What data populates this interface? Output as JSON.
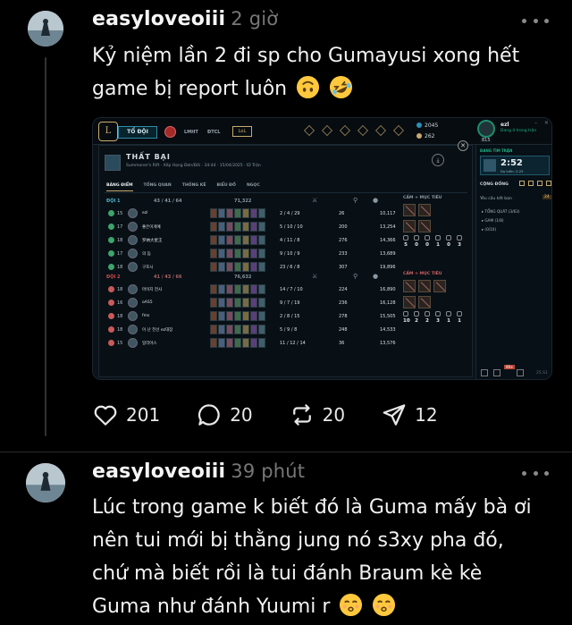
{
  "post1": {
    "username": "easyloveoiii",
    "time": "2 giờ",
    "text_line1": "Kỷ niệm lần 2 đi sp cho Gumayusi xong hết",
    "text_line2": "game bị report luôn",
    "emojis": [
      "upside-down-face-emoji",
      "rolling-on-floor-laughing-emoji"
    ],
    "stats": {
      "likes": "201",
      "comments": "20",
      "reposts": "20",
      "shares": "12"
    }
  },
  "post2": {
    "username": "easyloveoiii",
    "time": "39 phút",
    "lines": [
      "Lúc trong game k biết đó là Guma mấy bà ơi",
      "nên tui mới bị thằng jung nó s3xy pha đó,",
      "chứ mà biết rồi là tui đánh Braum kè kè",
      "Guma như đánh Yuumi r"
    ],
    "emojis": [
      "kissing-face-emoji",
      "kissing-face-emoji"
    ]
  },
  "game": {
    "play_button": "TỔ ĐỘI",
    "nav": [
      "LMHT",
      "ĐTCL"
    ],
    "lol_badge": "LoL",
    "currency_be": "2045",
    "currency_rp": "262",
    "profile_level": "815",
    "profile_name": "ezl",
    "profile_status": "Đang ở trong trận",
    "result_title": "THẤT BẠI",
    "result_meta": "Summoner's Rift · Xếp Hạng Đơn/Đôi · 34:44 · 15/04/2025 · ID Trận",
    "tabs": [
      "BẢNG ĐIỂM",
      "TỔNG QUAN",
      "THỐNG KÊ",
      "BIỂU ĐỒ",
      "NGỌC"
    ],
    "team1": {
      "name": "ĐỘI 1",
      "kills": "43 / 41 / 64",
      "gold": "71,322",
      "objectives_header": "CẤM + MỤC TIÊU",
      "objectives": [
        "5",
        "0",
        "0",
        "1",
        "0",
        "3"
      ],
      "players": [
        {
          "level": "15",
          "name": "ezl",
          "kda": "2 / 4 / 29",
          "cs": "26",
          "gold": "10,117"
        },
        {
          "level": "17",
          "name": "좋은이게예",
          "kda": "5 / 10 / 10",
          "cs": "200",
          "gold": "13,254"
        },
        {
          "level": "18",
          "name": "罗纳大星王",
          "kda": "4 / 11 / 8",
          "cs": "276",
          "gold": "14,366"
        },
        {
          "level": "17",
          "name": "의 듬",
          "kda": "9 / 10 / 9",
          "cs": "233",
          "gold": "13,689"
        },
        {
          "level": "18",
          "name": "구조시",
          "kda": "23 / 6 / 8",
          "cs": "307",
          "gold": "19,896"
        }
      ]
    },
    "team2": {
      "name": "ĐỘI 2",
      "kills": "41 / 43 / 66",
      "gold": "76,632",
      "objectives_header": "CẤM + MỤC TIÊU",
      "objectives": [
        "10",
        "2",
        "2",
        "3",
        "1",
        "1"
      ],
      "players": [
        {
          "level": "18",
          "name": "마이지 전사",
          "kda": "14 / 7 / 10",
          "cs": "224",
          "gold": "16,890"
        },
        {
          "level": "16",
          "name": "oAS5",
          "kda": "9 / 7 / 19",
          "cs": "236",
          "gold": "16,128"
        },
        {
          "level": "18",
          "name": "fms",
          "kda": "2 / 8 / 15",
          "cs": "278",
          "gold": "15,505"
        },
        {
          "level": "18",
          "name": "이 난 전선 ez대장",
          "kda": "5 / 9 / 8",
          "cs": "248",
          "gold": "14,533"
        },
        {
          "level": "15",
          "name": "일리아스",
          "kda": "11 / 12 / 14",
          "cs": "36",
          "gold": "13,576"
        }
      ]
    },
    "side": {
      "status": "ĐANG TÌM TRẬN",
      "timer": "2:52",
      "expected": "Dự kiến: 2:25",
      "community": "CỘNG ĐỒNG",
      "requests": "Yêu cầu kết bạn",
      "request_count": "24",
      "groups": [
        "▸ TỔNG QUÁT (3/63)",
        "▸ GAM (1/8)",
        "▸ (0/10)"
      ],
      "badge": "99+",
      "version": "25.S1"
    }
  },
  "colors": {
    "background": "#000000",
    "text": "#f3f3f3",
    "muted": "#777777",
    "thread_line": "#333333",
    "game_gold": "#c8aa6e",
    "game_teal": "#1fae83"
  }
}
